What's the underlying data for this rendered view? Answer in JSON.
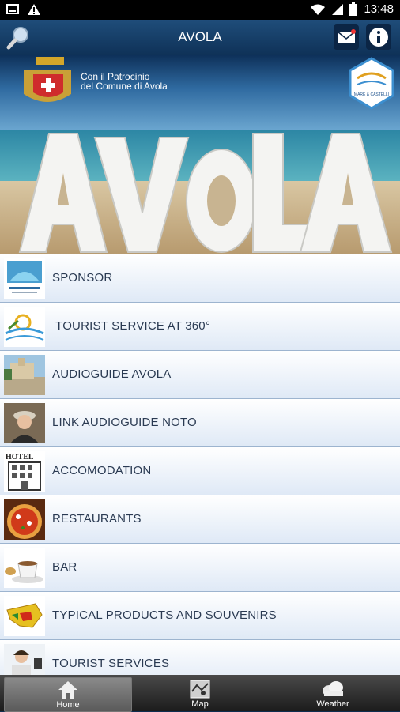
{
  "status": {
    "time": "13:48"
  },
  "header": {
    "title": "AVOLA"
  },
  "banner": {
    "patronage_line1": "Con il Patrocinio",
    "patronage_line2": "del Comune di Avola",
    "hero_text": "AVOLA",
    "badge_text": "MARE & CASTELLI"
  },
  "menu": {
    "items": [
      {
        "label": "SPONSOR"
      },
      {
        "label": " TOURIST SERVICE AT 360°"
      },
      {
        "label": "AUDIOGUIDE AVOLA"
      },
      {
        "label": "LINK AUDIOGUIDE NOTO"
      },
      {
        "label": "ACCOMODATION",
        "thumb_text": "HOTEL"
      },
      {
        "label": "RESTAURANTS"
      },
      {
        "label": "BAR"
      },
      {
        "label": "TYPICAL PRODUCTS AND SOUVENIRS"
      },
      {
        "label": "TOURIST SERVICES"
      }
    ]
  },
  "tabs": [
    {
      "label": "Home"
    },
    {
      "label": "Map"
    },
    {
      "label": "Weather"
    }
  ],
  "colors": {
    "appbar": "#1f4d7a",
    "row_bottom": "#dfe9f6",
    "label": "#2a3a52"
  }
}
